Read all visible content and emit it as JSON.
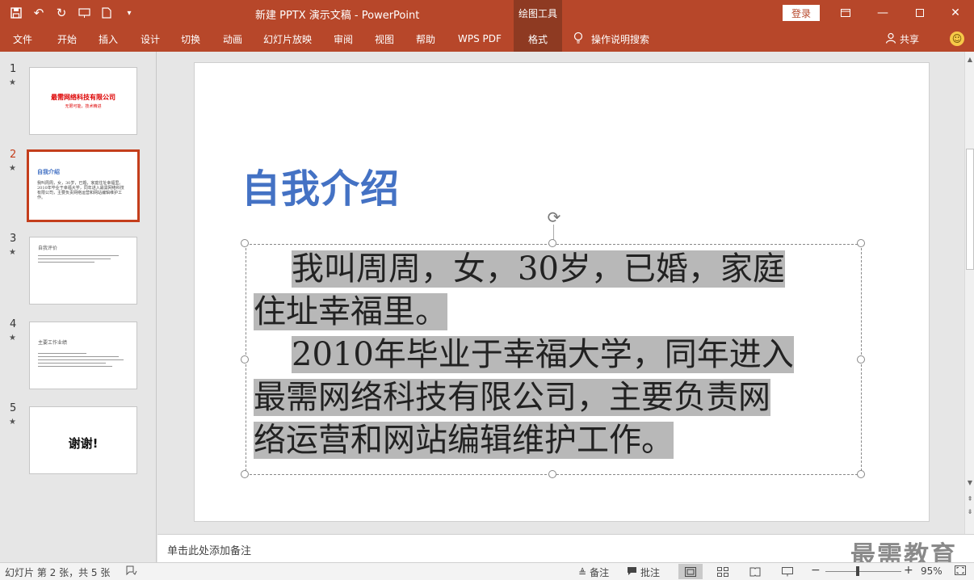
{
  "window": {
    "title": "新建 PPTX 演示文稿 - PowerPoint",
    "tool_tab_title": "绘图工具",
    "login": "登录"
  },
  "ribbon": {
    "tabs": [
      "文件",
      "开始",
      "插入",
      "设计",
      "切换",
      "动画",
      "幻灯片放映",
      "审阅",
      "视图",
      "帮助",
      "WPS PDF",
      "格式"
    ],
    "active_tab": "格式",
    "tell_me": "操作说明搜索",
    "share": "共享"
  },
  "thumbnails": [
    {
      "num": "1",
      "title": "最需网络科技有限公司",
      "sub": "无限可能，技术精进"
    },
    {
      "num": "2",
      "title": "自我介绍",
      "body": "我叫周周，女，30岁，已婚，家庭住址幸福里。2010年毕业于幸福大学，同年进入最需网络科技有限公司，主要负责网络运营和网站编辑维护工作。"
    },
    {
      "num": "3",
      "title": "自我评价"
    },
    {
      "num": "4",
      "title": "主要工作业绩"
    },
    {
      "num": "5",
      "title": "谢谢!"
    }
  ],
  "slide": {
    "title": "自我介绍",
    "para1_line1": "我叫周周，女，30岁，已婚，家庭",
    "para1_line2": "住址幸福里。",
    "para2_line1": "2010年毕业于幸福大学，同年进入",
    "para2_line2": "最需网络科技有限公司，主要负责网",
    "para2_line3": "络运营和网站编辑维护工作。"
  },
  "notes": {
    "placeholder": "单击此处添加备注",
    "watermark": "最需教育"
  },
  "status": {
    "slide_info": "幻灯片 第 2 张，共 5 张",
    "notes_btn": "备注",
    "comments_btn": "批注",
    "zoom": "95%"
  },
  "colors": {
    "accent": "#b7472a",
    "title_blue": "#4472c4",
    "selection_gray": "#b8b8b8"
  }
}
